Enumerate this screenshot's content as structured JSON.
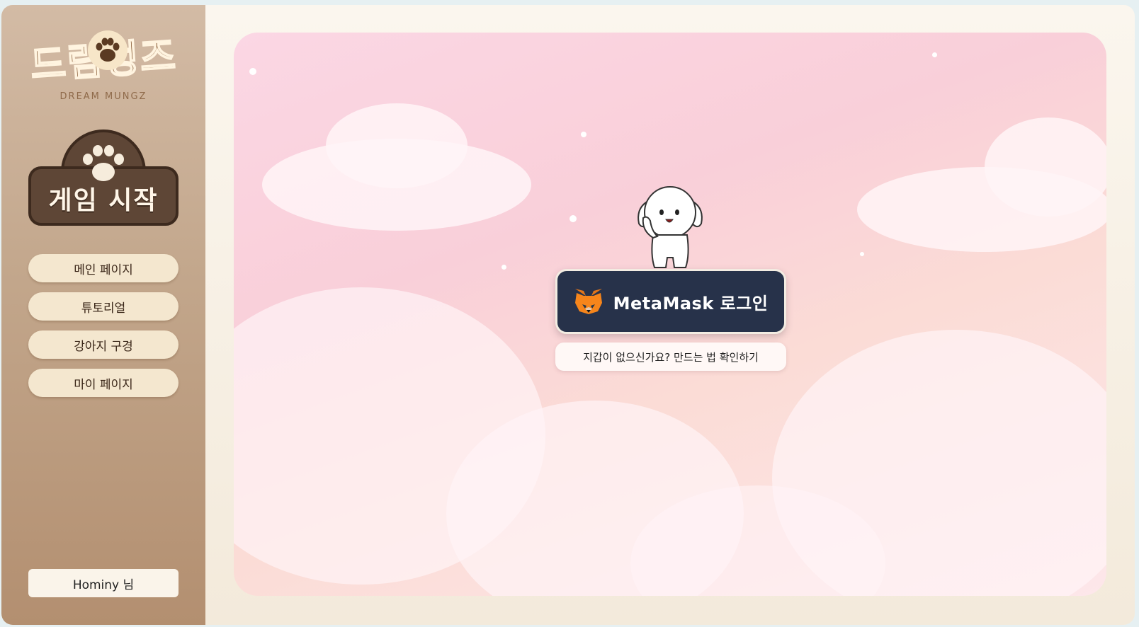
{
  "brand": {
    "logo_text": "드림멍즈",
    "logo_subtitle": "DREAM MUNGZ"
  },
  "sidebar": {
    "game_start_label": "게임 시작",
    "nav": [
      {
        "label": "메인 페이지"
      },
      {
        "label": "튜토리얼"
      },
      {
        "label": "강아지 구경"
      },
      {
        "label": "마이 페이지"
      }
    ],
    "user_label": "Hominy 님"
  },
  "main": {
    "login_button_label": "MetaMask 로그인",
    "login_icon": "metamask-fox-icon",
    "help_link_label": "지갑이 없으신가요? 만드는 법 확인하기"
  },
  "colors": {
    "sidebar_top": "#d3bba5",
    "sidebar_bottom": "#b38f70",
    "login_button": "#27324a",
    "nav_item": "#f4e7cf",
    "stage_pink": "#fbd7e4"
  }
}
